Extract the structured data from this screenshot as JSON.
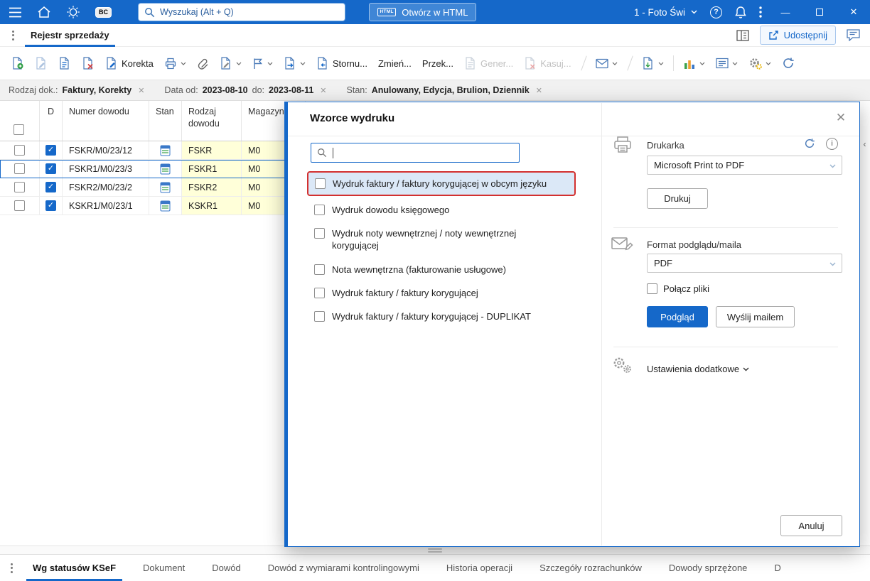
{
  "topbar": {
    "search_placeholder": "Wyszukaj (Alt + Q)",
    "bc_badge": "BC",
    "html_badge": "HTML",
    "open_html": "Otwórz w HTML",
    "company": "1 - Foto Świ"
  },
  "tabbar": {
    "active_tab": "Rejestr sprzedaży",
    "share": "Udostępnij"
  },
  "toolbar": {
    "korekta": "Korekta",
    "storno": "Stornu...",
    "zmien": "Zmień...",
    "przekaz": "Przek...",
    "generuj": "Gener...",
    "kasuj": "Kasuj..."
  },
  "filters": [
    {
      "kv": [
        {
          "k": "Rodzaj dok.:",
          "v": "Faktury, Korekty"
        }
      ]
    },
    {
      "kv": [
        {
          "k": "Data od:",
          "v": "2023-08-10"
        },
        {
          "k": "do:",
          "v": "2023-08-11"
        }
      ]
    },
    {
      "kv": [
        {
          "k": "Stan:",
          "v": "Anulowany, Edycja, Brulion, Dziennik"
        }
      ]
    }
  ],
  "table": {
    "headers": {
      "d": "D",
      "numer": "Numer dowodu",
      "stan": "Stan",
      "rodzaj": "Rodzaj dowodu",
      "magazyn": "Magazyn"
    },
    "rows": [
      {
        "numer": "FSKR/M0/23/12",
        "rodzaj": "FSKR",
        "magazyn": "M0"
      },
      {
        "numer": "FSKR1/M0/23/3",
        "rodzaj": "FSKR1",
        "magazyn": "M0"
      },
      {
        "numer": "FSKR2/M0/23/2",
        "rodzaj": "FSKR2",
        "magazyn": "M0"
      },
      {
        "numer": "KSKR1/M0/23/1",
        "rodzaj": "KSKR1",
        "magazyn": "M0"
      }
    ]
  },
  "modal": {
    "title": "Wzorce wydruku",
    "templates": [
      "Wydruk faktury / faktury korygującej w obcym języku",
      "Wydruk dowodu księgowego",
      "Wydruk noty wewnętrznej / noty wewnętrznej korygującej",
      "Nota wewnętrzna (fakturowanie usługowe)",
      "Wydruk faktury / faktury korygującej",
      "Wydruk faktury / faktury korygującej - DUPLIKAT"
    ],
    "printer_label": "Drukarka",
    "printer_value": "Microsoft Print to PDF",
    "print_button": "Drukuj",
    "format_label": "Format podglądu/maila",
    "format_value": "PDF",
    "merge_files": "Połącz pliki",
    "preview_button": "Podgląd",
    "mail_button": "Wyślij mailem",
    "settings_more": "Ustawienia dodatkowe",
    "cancel_button": "Anuluj"
  },
  "bottom_tabs": [
    "Wg statusów KSeF",
    "Dokument",
    "Dowód",
    "Dowód z wymiarami kontrolingowymi",
    "Historia operacji",
    "Szczegóły rozrachunków",
    "Dowody sprzężone",
    "D"
  ],
  "colors": {
    "accent": "#1568c9",
    "highlight_border": "#d3302f",
    "highlight_bg": "#dbe8f7",
    "cell_yellow": "#ffffd9",
    "topbar": "#1568c9"
  }
}
